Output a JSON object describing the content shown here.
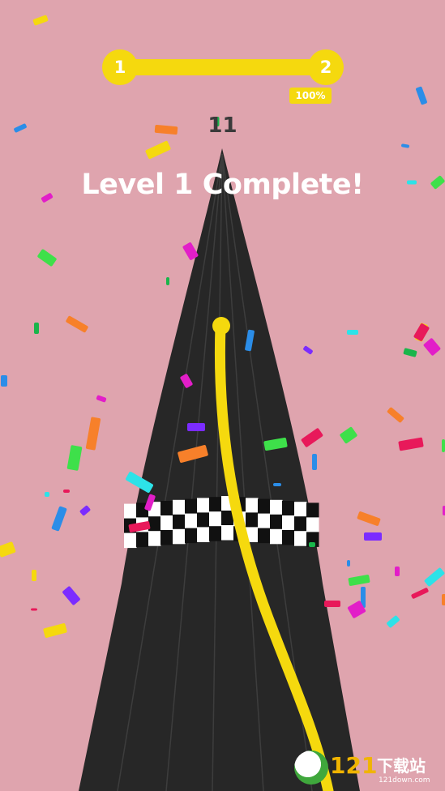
{
  "progress": {
    "current_level": "1",
    "next_level": "2",
    "percent_label": "100%",
    "fraction": 1.0
  },
  "hud": {
    "score": "11",
    "headline": "Level 1 Complete!"
  },
  "watermark": {
    "text": "121下载站",
    "subtext": "121down.com"
  },
  "colors": {
    "background": "#dfa4ae",
    "road": "#272727",
    "line": "#f5d90e",
    "progress": "#f5d90e"
  }
}
